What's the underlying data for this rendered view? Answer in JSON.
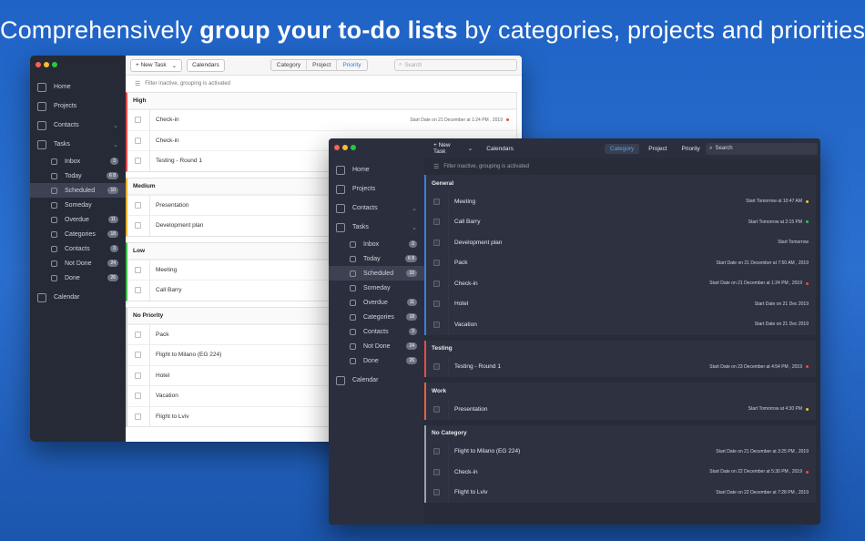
{
  "headline": {
    "part1": "Comprehensively ",
    "bold": "group your to-do lists",
    "part2": " by categories, projects and priorities"
  },
  "light": {
    "sidebar": {
      "home": "Home",
      "projects": "Projects",
      "contacts": "Contacts",
      "tasks": "Tasks",
      "items": [
        {
          "label": "Inbox",
          "count": "3"
        },
        {
          "label": "Today",
          "count": "6 8"
        },
        {
          "label": "Scheduled",
          "count": "10"
        },
        {
          "label": "Someday",
          "count": ""
        },
        {
          "label": "Overdue",
          "count": "11"
        },
        {
          "label": "Categories",
          "count": "18"
        },
        {
          "label": "Contacts",
          "count": "3"
        },
        {
          "label": "Not Done",
          "count": "24"
        },
        {
          "label": "Done",
          "count": "26"
        }
      ],
      "calendar": "Calendar"
    },
    "toolbar": {
      "new_task": "+ New Task",
      "calendars": "Calendars",
      "tabs": [
        "Category",
        "Project",
        "Priority"
      ],
      "search": "Search"
    },
    "filter": "Filter inactive, grouping is activated",
    "groups": [
      {
        "name": "High",
        "color": "#e84a4a",
        "tasks": [
          {
            "name": "Check-in",
            "meta": "Start Date on 21 December at 1:24 PM , 2019",
            "dot": "#e84a4a"
          },
          {
            "name": "Check-in",
            "meta": "",
            "dot": ""
          },
          {
            "name": "Testing - Round 1",
            "meta": "",
            "dot": ""
          }
        ]
      },
      {
        "name": "Medium",
        "color": "#f0b22f",
        "tasks": [
          {
            "name": "Presentation",
            "meta": "",
            "dot": ""
          },
          {
            "name": "Development plan",
            "meta": "",
            "dot": ""
          }
        ]
      },
      {
        "name": "Low",
        "color": "#3bbf4a",
        "tasks": [
          {
            "name": "Meeting",
            "meta": "",
            "dot": ""
          },
          {
            "name": "Call Barry",
            "meta": "",
            "dot": ""
          }
        ]
      },
      {
        "name": "No Priority",
        "color": "#cccccc",
        "tasks": [
          {
            "name": "Pack",
            "meta": "",
            "dot": ""
          },
          {
            "name": "Flight to Milano (EG 224)",
            "meta": "",
            "dot": ""
          },
          {
            "name": "Hotel",
            "meta": "",
            "dot": ""
          },
          {
            "name": "Vacation",
            "meta": "",
            "dot": ""
          },
          {
            "name": "Flight to Lviv",
            "meta": "",
            "dot": ""
          }
        ]
      }
    ]
  },
  "dark": {
    "sidebar": {
      "home": "Home",
      "projects": "Projects",
      "contacts": "Contacts",
      "tasks": "Tasks",
      "items": [
        {
          "label": "Inbox",
          "count": "3"
        },
        {
          "label": "Today",
          "count": "6 8"
        },
        {
          "label": "Scheduled",
          "count": "10"
        },
        {
          "label": "Someday",
          "count": ""
        },
        {
          "label": "Overdue",
          "count": "11"
        },
        {
          "label": "Categories",
          "count": "18"
        },
        {
          "label": "Contacts",
          "count": "3"
        },
        {
          "label": "Not Done",
          "count": "24"
        },
        {
          "label": "Done",
          "count": "26"
        }
      ],
      "calendar": "Calendar"
    },
    "toolbar": {
      "new_task": "+ New Task",
      "calendars": "Calendars",
      "tabs": [
        "Category",
        "Project",
        "Priority"
      ],
      "search": "Search"
    },
    "filter": "Filter inactive, grouping is activated",
    "groups": [
      {
        "name": "General",
        "color": "#3d7de0",
        "tasks": [
          {
            "name": "Meeting",
            "meta": "Start Tomorrow at 10:47 AM",
            "dot": "#f0c430"
          },
          {
            "name": "Call Barry",
            "meta": "Start Tomorrow at 2:15 PM",
            "dot": "#3bbf4a"
          },
          {
            "name": "Development plan",
            "meta": "Start Tomorrow",
            "dot": ""
          },
          {
            "name": "Pack",
            "meta": "Start Date on 21 December at 7:50 AM , 2019",
            "dot": ""
          },
          {
            "name": "Check-in",
            "meta": "Start Date on 21 December at 1:24 PM , 2019",
            "dot": "#e84a4a"
          },
          {
            "name": "Hotel",
            "meta": "Start Date on 21 Dec 2019",
            "dot": ""
          },
          {
            "name": "Vacation",
            "meta": "Start Date on 21 Dec 2019",
            "dot": ""
          }
        ]
      },
      {
        "name": "Testing",
        "color": "#e84a4a",
        "tasks": [
          {
            "name": "Testing - Round 1",
            "meta": "Start Date on 23 December at 4:54 PM , 2019",
            "dot": "#e84a4a"
          }
        ]
      },
      {
        "name": "Work",
        "color": "#e8623a",
        "tasks": [
          {
            "name": "Presentation",
            "meta": "Start Tomorrow at 4:30 PM",
            "dot": "#f0c430"
          }
        ]
      },
      {
        "name": "No Category",
        "color": "#9aa0ad",
        "tasks": [
          {
            "name": "Flight to Milano (EG 224)",
            "meta": "Start Date on 21 December at 3:25 PM , 2019",
            "dot": ""
          },
          {
            "name": "Check-in",
            "meta": "Start Date on 22 December at 5:30 PM , 2019",
            "dot": "#e84a4a"
          },
          {
            "name": "Flight to Lviv",
            "meta": "Start Date on 22 December at 7:28 PM , 2019",
            "dot": ""
          }
        ]
      }
    ]
  }
}
